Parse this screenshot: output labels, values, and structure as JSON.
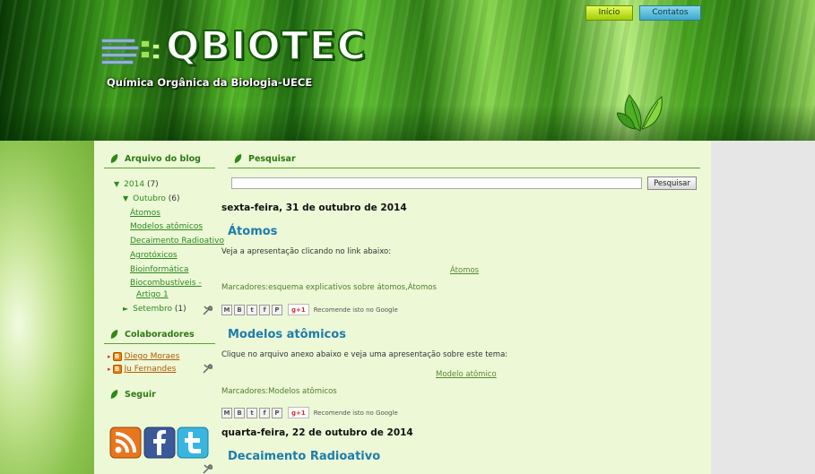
{
  "header": {
    "logo_text": "QBIOTEC",
    "tagline": "Química Orgânica da Biologia-UECE",
    "nav": {
      "inicio": "Início",
      "contatos": "Contatos"
    }
  },
  "colors": {
    "accent_green": "#2e7a14",
    "post_title_blue": "#1e7dab",
    "link_green": "#2b8a20"
  },
  "sidebar": {
    "archive": {
      "title": "Arquivo do blog",
      "year": {
        "label": "2014",
        "count": "(7)"
      },
      "month": {
        "label": "Outubro",
        "count": "(6)"
      },
      "posts": [
        "Átomos",
        "Modelos atômicos",
        "Decaimento Radioativo",
        "Agrotóxicos",
        "Bioinformática",
        "Biocombustíveis -",
        "Artigo 1"
      ],
      "collapsed_month": {
        "label": "Setembro",
        "count": "(1)"
      }
    },
    "contributors": {
      "title": "Colaboradores",
      "people": [
        "Diego Moraes",
        "Ju Fernandes"
      ]
    },
    "follow": {
      "title": "Seguir",
      "icons": [
        "rss-icon",
        "facebook-icon",
        "twitter-icon"
      ]
    }
  },
  "search": {
    "title": "Pesquisar",
    "button": "Pesquisar",
    "value": ""
  },
  "posts": [
    {
      "date": "sexta-feira, 31 de outubro de 2014",
      "title": "Átomos",
      "text": "Veja a apresentação clicando no link abaixo:",
      "link": "Átomos",
      "labels": "Marcadores:esquema explicativos sobre átomos,Átomos"
    },
    {
      "title": "Modelos atômicos",
      "text": "Clique no arquivo anexo abaixo e veja uma apresentação sobre este tema:",
      "link": "Modelo atômico",
      "labels": "Marcadores:Modelos atômicos"
    },
    {
      "date": "quarta-feira, 22 de outubro de 2014",
      "title": "Decaimento Radioativo"
    }
  ],
  "share": {
    "gplus": "g+1",
    "recommend": "Recomende isto no Google",
    "buttons": [
      "M",
      "B",
      "t",
      "f",
      "P"
    ]
  }
}
